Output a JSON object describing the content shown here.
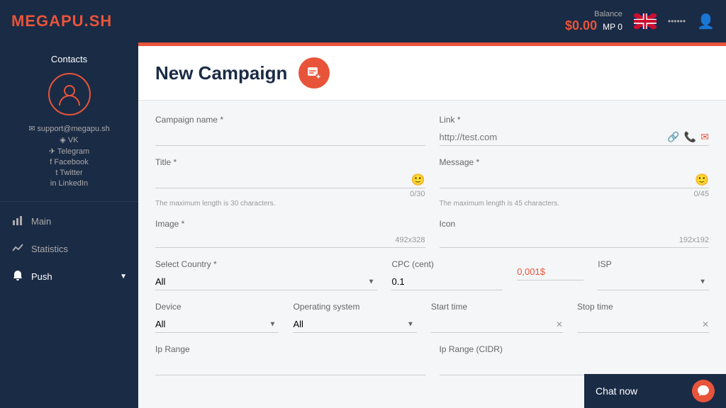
{
  "topNav": {
    "logo": "MEGAPU.SH",
    "toggleIcon": "‹",
    "balance": {
      "label": "Balance",
      "amount": "$0.00",
      "mp": "MP 0"
    },
    "username": "••••••"
  },
  "sidebar": {
    "contacts": "Contacts",
    "socialLinks": [
      {
        "icon": "✉",
        "label": "support@megapu.sh"
      },
      {
        "icon": "◈",
        "label": "VK"
      },
      {
        "icon": "✈",
        "label": "Telegram"
      },
      {
        "icon": "f",
        "label": "Facebook"
      },
      {
        "icon": "t",
        "label": "Twitter"
      },
      {
        "icon": "in",
        "label": "LinkedIn"
      }
    ],
    "navItems": [
      {
        "id": "main",
        "icon": "📊",
        "label": "Main",
        "hasArrow": false
      },
      {
        "id": "statistics",
        "icon": "📈",
        "label": "Statistics",
        "hasArrow": false
      },
      {
        "id": "push",
        "icon": "🔔",
        "label": "Push",
        "hasArrow": true
      }
    ]
  },
  "page": {
    "title": "New Campaign",
    "campaignIconChar": "🗨"
  },
  "form": {
    "campaignName": {
      "label": "Campaign name *",
      "value": "",
      "placeholder": ""
    },
    "link": {
      "label": "Link *",
      "placeholder": "http://test.com",
      "value": ""
    },
    "title": {
      "label": "Title *",
      "charCount": "0/30",
      "maxHint": "The maximum length is 30 characters.",
      "value": ""
    },
    "message": {
      "label": "Message *",
      "charCount": "0/45",
      "maxHint": "The maximum length is 45 characters.",
      "value": ""
    },
    "image": {
      "label": "Image *",
      "size": "492x328"
    },
    "icon": {
      "label": "Icon",
      "size": "192x192"
    },
    "selectCountry": {
      "label": "Select Country *",
      "value": "All"
    },
    "cpc": {
      "label": "CPC (cent)",
      "value": "0.1"
    },
    "cpcMin": "0,001$",
    "isp": {
      "label": "ISP"
    },
    "device": {
      "label": "Device",
      "value": "All"
    },
    "operatingSystem": {
      "label": "Operating system",
      "value": "All"
    },
    "startTime": {
      "label": "Start time",
      "value": ""
    },
    "stopTime": {
      "label": "Stop time",
      "value": ""
    },
    "ipRange": {
      "label": "Ip Range",
      "value": ""
    },
    "ipRangeCIDR": {
      "label": "Ip Range (CIDR)",
      "value": ""
    }
  },
  "chat": {
    "label": "Chat now",
    "icon": "💬"
  }
}
